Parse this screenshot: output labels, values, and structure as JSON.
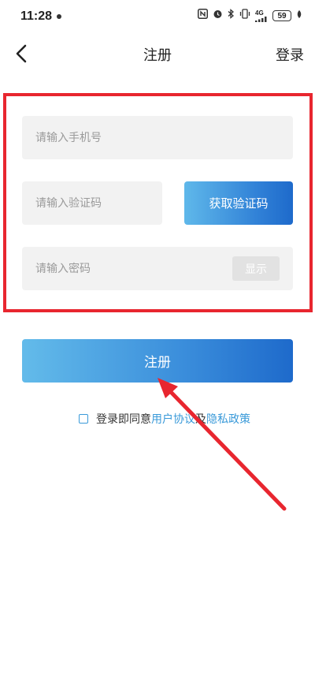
{
  "status_bar": {
    "time": "11:28",
    "network": "4G",
    "battery": "59",
    "icons": [
      "nfc-icon",
      "alarm-icon",
      "bluetooth-icon",
      "vibrate-icon",
      "signal-icon",
      "battery-icon",
      "leaf-icon"
    ]
  },
  "nav": {
    "back_icon": "chevron-left-icon",
    "title": "注册",
    "login_label": "登录"
  },
  "form": {
    "phone_placeholder": "请输入手机号",
    "code_placeholder": "请输入验证码",
    "get_code_label": "获取验证码",
    "password_placeholder": "请输入密码",
    "show_label": "显示"
  },
  "register_label": "注册",
  "agreement": {
    "prefix": "登录即同意",
    "user_agreement": "用户协议",
    "conjunction": "及",
    "privacy_policy": "隐私政策"
  },
  "colors": {
    "accent": "#3a9ad9",
    "button_gradient_start": "#63bbea",
    "button_gradient_end": "#1e6acb",
    "annotation_red": "#e8262f"
  }
}
